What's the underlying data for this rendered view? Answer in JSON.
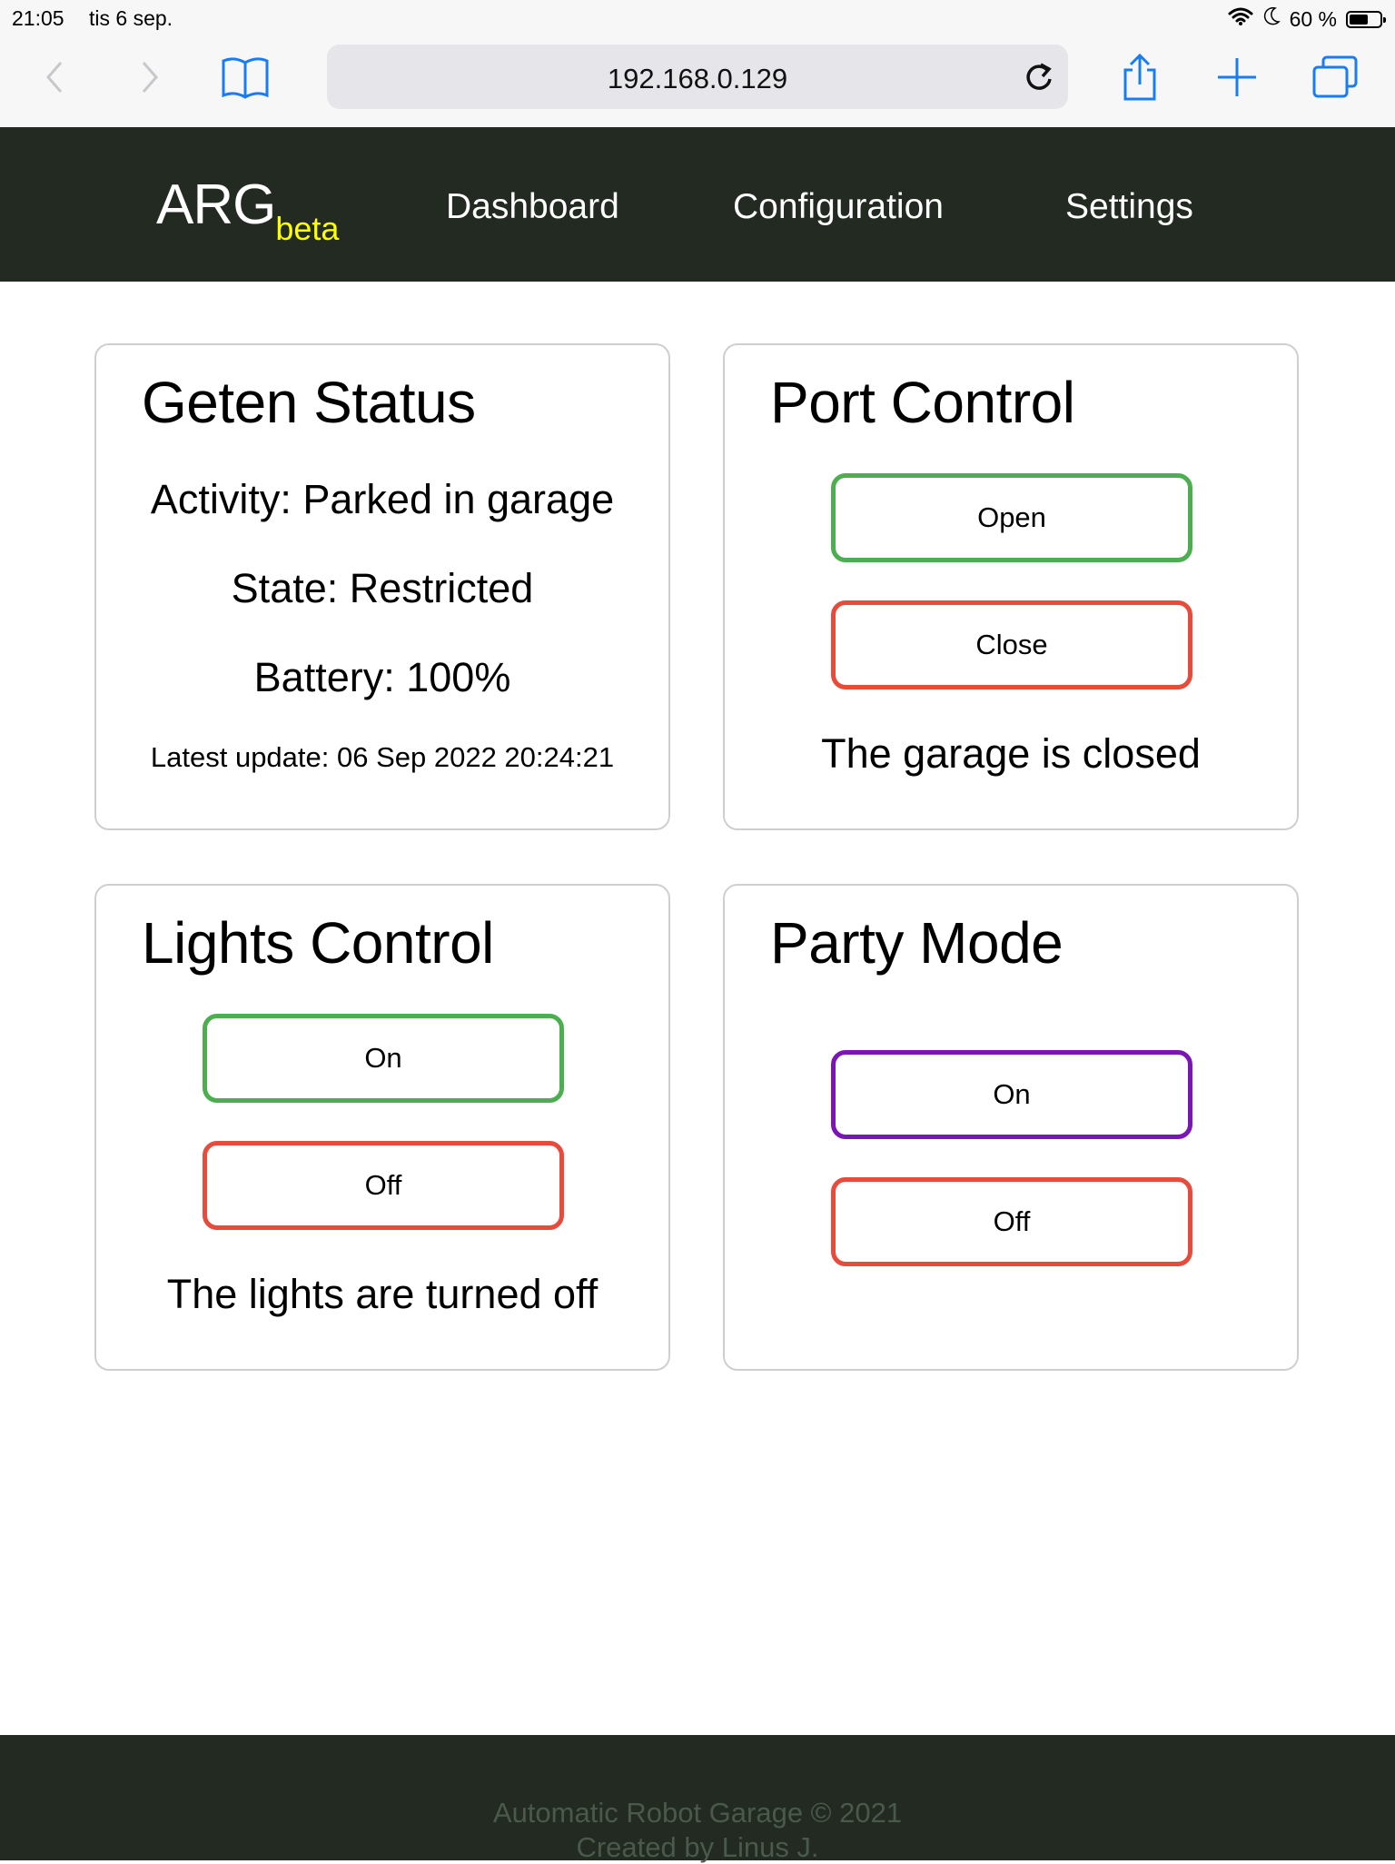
{
  "statusbar": {
    "time": "21:05",
    "date": "tis 6 sep.",
    "battery": "60 %",
    "battery_level": 0.6
  },
  "browser": {
    "url": "192.168.0.129"
  },
  "nav": {
    "brand": "ARG",
    "brand_sub": "beta",
    "links": [
      "Dashboard",
      "Configuration",
      "Settings"
    ]
  },
  "status_card": {
    "title": "Geten Status",
    "activity": "Activity: Parked in garage",
    "state": "State: Restricted",
    "battery": "Battery: 100%",
    "latest_update": "Latest update: 06 Sep 2022 20:24:21"
  },
  "port_card": {
    "title": "Port Control",
    "open_label": "Open",
    "close_label": "Close",
    "status": "The garage is closed"
  },
  "lights_card": {
    "title": "Lights Control",
    "on_label": "On",
    "off_label": "Off",
    "status": "The lights are turned off"
  },
  "party_card": {
    "title": "Party Mode",
    "on_label": "On",
    "off_label": "Off"
  },
  "footer": {
    "line1": "Automatic Robot Garage © 2021",
    "line2": "Created by Linus J."
  },
  "colors": {
    "nav_bg": "#222a22",
    "brand_beta": "#ffff00",
    "button_green": "#4cae4f",
    "button_red": "#e74b3c",
    "button_purple": "#7a16b3",
    "ios_blue": "#1a7cf2"
  }
}
